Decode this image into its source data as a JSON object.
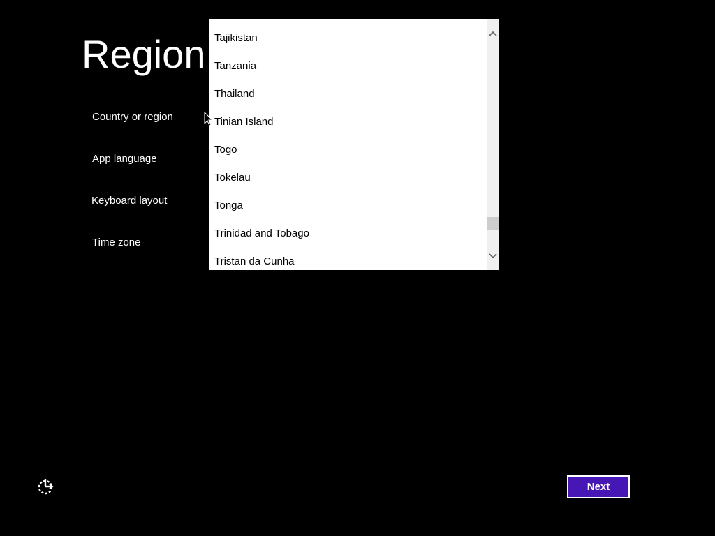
{
  "page": {
    "title": "Region"
  },
  "fields": {
    "country_label": "Country or region",
    "app_language_label": "App language",
    "keyboard_label": "Keyboard layout",
    "timezone_label": "Time zone"
  },
  "country_dropdown": {
    "items": [
      "Tajikistan",
      "Tanzania",
      "Thailand",
      "Tinian Island",
      "Togo",
      "Tokelau",
      "Tonga",
      "Trinidad and Tobago",
      "Tristan da Cunha"
    ],
    "scroll_position": 0.85
  },
  "footer": {
    "next_label": "Next",
    "ease_of_access_icon": "ease-of-access-icon"
  },
  "colors": {
    "background": "#000000",
    "accent": "#4617b4",
    "text": "#ffffff",
    "list_text": "#000000"
  }
}
